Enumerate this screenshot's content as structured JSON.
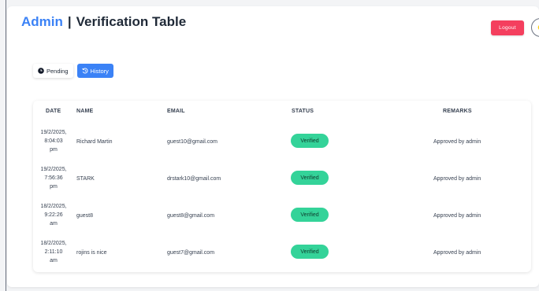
{
  "header": {
    "brand": "Admin",
    "separator": "|",
    "title": "Verification Table",
    "logout_label": "Logout"
  },
  "tabs": [
    {
      "label": "Pending",
      "icon": "clock-icon"
    },
    {
      "label": "History",
      "icon": "history-icon"
    }
  ],
  "table": {
    "columns": [
      "DATE",
      "NAME",
      "EMAIL",
      "STATUS",
      "REMARKS"
    ],
    "rows": [
      {
        "date": "19/2/2025,\n8:04:03\npm",
        "name": "Richard Martin",
        "email": "guest10@gmail.com",
        "status": "Verified",
        "remarks": "Approved by admin"
      },
      {
        "date": "19/2/2025,\n7:56:36\npm",
        "name": "STARK",
        "email": "drstark10@gmail.com",
        "status": "Verified",
        "remarks": "Approved by admin"
      },
      {
        "date": "18/2/2025,\n9:22:26\nam",
        "name": "guest8",
        "email": "guest8@gmail.com",
        "status": "Verified",
        "remarks": "Approved by admin"
      },
      {
        "date": "18/2/2025,\n2:11:10\nam",
        "name": "rojins is nice",
        "email": "guest7@gmail.com",
        "status": "Verified",
        "remarks": "Approved by admin"
      }
    ]
  },
  "colors": {
    "brand": "#3b82f6",
    "logout": "#f43f5e",
    "active_tab": "#3b82f6",
    "verified_badge": "#34d399"
  }
}
